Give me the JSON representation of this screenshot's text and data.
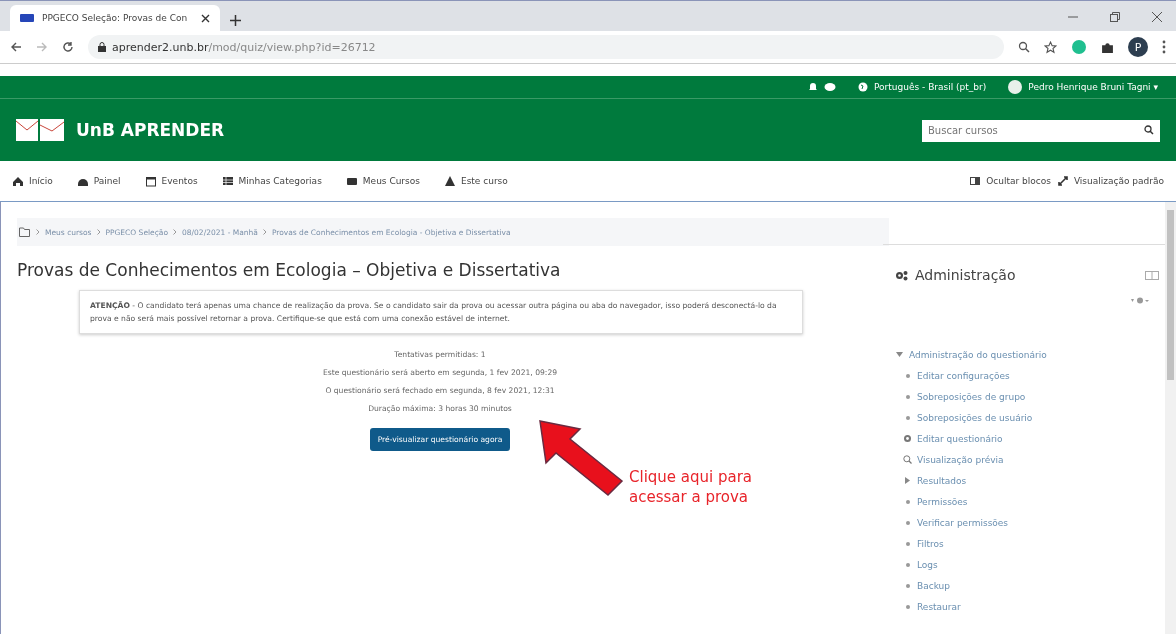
{
  "browser": {
    "tab_title": "PPGECO Seleção: Provas de Con",
    "url_host": "aprender2.unb.br",
    "url_path": "/mod/quiz/view.php?id=26712",
    "profile_initial": "P"
  },
  "user_bar": {
    "language": "Português - Brasil (pt_br)",
    "user_name": "Pedro Henrique Bruni Tagni",
    "menu_caret": "▾"
  },
  "header": {
    "site_name": "UnB APRENDER",
    "search": {
      "placeholder": "Buscar cursos"
    }
  },
  "nav": {
    "items": [
      {
        "label": "Início",
        "kind": "home"
      },
      {
        "label": "Painel",
        "kind": "dashboard"
      },
      {
        "label": "Eventos",
        "kind": "calendar"
      },
      {
        "label": "Minhas Categorias",
        "kind": "list"
      },
      {
        "label": "Meus Cursos",
        "kind": "folder"
      },
      {
        "label": "Este curso",
        "kind": "course"
      }
    ],
    "right": [
      {
        "label": "Ocultar blocos",
        "kind": "blocks"
      },
      {
        "label": "Visualização padrão",
        "kind": "expand"
      }
    ]
  },
  "breadcrumb": [
    "Meus cursos",
    "PPGECO Seleção",
    "08/02/2021 - Manhã",
    "Provas de Conhecimentos em Ecologia - Objetiva e Dissertativa"
  ],
  "page_title": "Provas de Conhecimentos em Ecologia – Objetiva e Dissertativa",
  "notice": "**ATENÇÃO** - O candidato terá apenas uma chance de realização da prova. Se o candidato sair da prova ou acessar outra página ou aba do navegador, isso poderá desconectá-lo da prova e não será mais possível retornar a prova. Certifique-se que está com uma conexão estável de internet.",
  "quiz_info": [
    "Tentativas permitidas: 1",
    "Este questionário será aberto em segunda, 1 fev 2021, 09:29",
    "O questionário será fechado em segunda, 8 fev 2021, 12:31",
    "Duração máxima: 3 horas 30 minutos"
  ],
  "preview_button": "Pré-visualizar questionário agora",
  "annotation": {
    "text": "Clique aqui para acessar a prova"
  },
  "sidebar": {
    "title": "Administração",
    "tree": [
      {
        "label": "Administração do questionário",
        "kind": "folder",
        "expanded": true,
        "children": [
          {
            "label": "Editar configurações",
            "kind": "bullet"
          },
          {
            "label": "Sobreposições de grupo",
            "kind": "bullet"
          },
          {
            "label": "Sobreposições de usuário",
            "kind": "bullet"
          },
          {
            "label": "Editar questionário",
            "kind": "gear"
          },
          {
            "label": "Visualização prévia",
            "kind": "search"
          },
          {
            "label": "Resultados",
            "kind": "folder",
            "expanded": false
          },
          {
            "label": "Permissões",
            "kind": "bullet"
          },
          {
            "label": "Verificar permissões",
            "kind": "bullet"
          },
          {
            "label": "Filtros",
            "kind": "bullet"
          },
          {
            "label": "Logs",
            "kind": "bullet"
          },
          {
            "label": "Backup",
            "kind": "bullet"
          },
          {
            "label": "Restaurar",
            "kind": "bullet"
          }
        ]
      }
    ]
  }
}
